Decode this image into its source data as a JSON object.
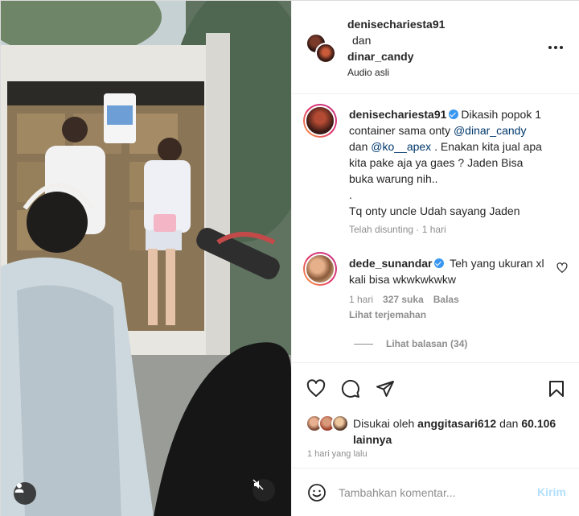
{
  "header": {
    "username_1": "denisechariesta91",
    "joiner": "dan",
    "username_2": "dinar_candy",
    "audio": "Audio asli",
    "more_icon": "more-horizontal-icon"
  },
  "caption": {
    "username": "denisechariesta91",
    "text_1": "Dikasih popok 1 container sama onty ",
    "mention_1": "@dinar_candy",
    "text_2": " dan ",
    "mention_2": "@ko__apex",
    "text_3": " . Enakan kita jual apa kita pake aja ya gaes ? Jaden Bisa buka warung nih..",
    "text_4": ".",
    "text_5": "Tq onty uncle Udah sayang Jaden",
    "edited": "Telah disunting",
    "separator": "·",
    "time": "1 hari"
  },
  "comment": {
    "username": "dede_sunandar",
    "text": "Teh yang ukuran xl kali bisa wkwkwkwkw",
    "time": "1 hari",
    "likes": "327 suka",
    "reply": "Balas",
    "translate": "Lihat terjemahan",
    "view_replies": "Lihat balasan (34)"
  },
  "actions": {
    "like_icon": "heart-icon",
    "comment_icon": "comment-icon",
    "share_icon": "send-icon",
    "save_icon": "bookmark-icon",
    "liked_by_prefix": "Disukai oleh ",
    "liked_by_user": "anggitasari612",
    "liked_by_mid": " dan ",
    "liked_by_count": "60.106",
    "liked_by_suffix": "lainnya",
    "posted_time": "1 hari yang lalu"
  },
  "add_comment": {
    "placeholder": "Tambahkan komentar...",
    "post_label": "Kirim",
    "emoji_icon": "emoji-icon"
  },
  "media": {
    "user_tag_icon": "user-icon",
    "mute_icon": "speaker-muted-icon"
  },
  "colors": {
    "verified": "#3897f0",
    "mention": "#00376b",
    "secondary_text": "#8e8e8e",
    "post_disabled": "#b2dffc"
  }
}
